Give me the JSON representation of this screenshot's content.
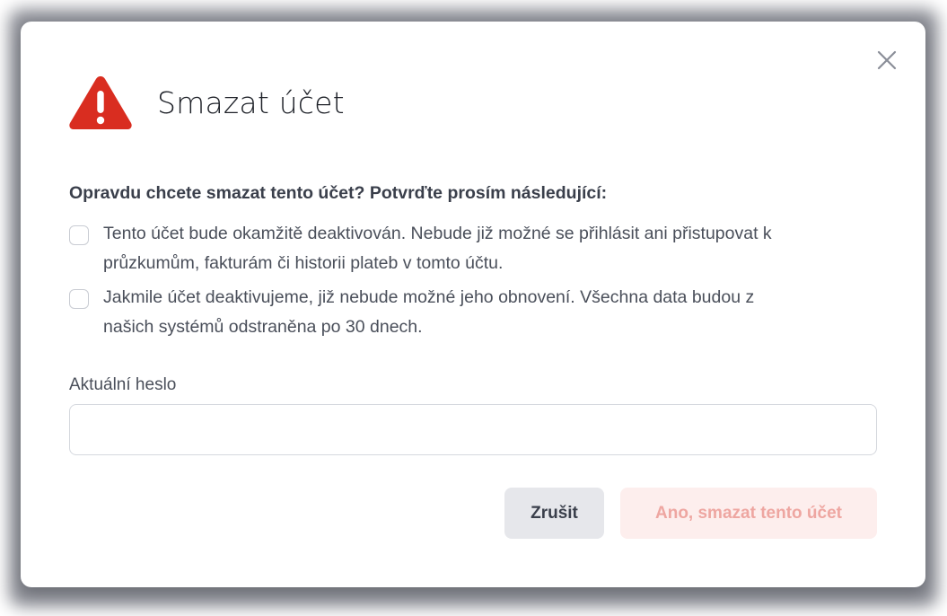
{
  "dialog": {
    "title": "Smazat účet",
    "close_icon": "close-icon",
    "warning_icon": "warning-triangle-icon",
    "question": "Opravdu chcete smazat tento účet? Potvrďte prosím následující:",
    "confirmations": [
      {
        "line1": "Tento účet bude okamžitě deaktivován. Nebude již možné se přihlásit ani přistupovat k",
        "line2": "průzkumům, fakturám či historii plateb v tomto účtu.",
        "checked": false
      },
      {
        "line1": "Jakmile účet deaktivujeme, již nebude možné jeho obnovení. Všechna data budou z",
        "line2": "našich systémů odstraněna po 30 dnech.",
        "checked": false
      }
    ],
    "password": {
      "label": "Aktuální heslo",
      "value": "",
      "placeholder": ""
    },
    "buttons": {
      "cancel": "Zrušit",
      "confirm": "Ano, smazat tento účet"
    }
  },
  "colors": {
    "danger": "#d92d20",
    "danger_light_bg": "#fdeeed",
    "danger_light_text": "#eea6a1",
    "neutral_button_bg": "#e6e7eb",
    "text_dark": "#1e2128",
    "text_body": "#4a4f5a"
  }
}
